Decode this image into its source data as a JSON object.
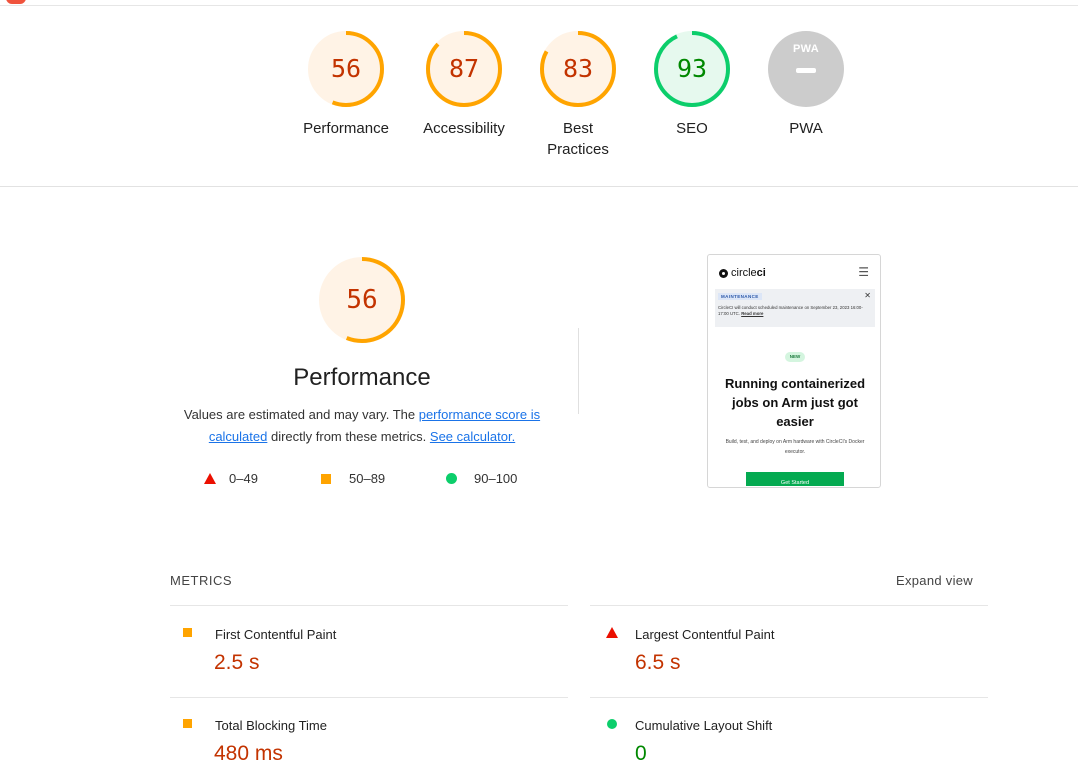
{
  "colors": {
    "fail": "#eb0f00",
    "average": "#ffa400",
    "pass": "#0cce6b",
    "fail_text": "#c33300",
    "average_text": "#c33300",
    "pass_text": "#008800",
    "na": "#cccccc",
    "link": "#1a73e8"
  },
  "categories": [
    {
      "score": "56",
      "label": "Performance",
      "rating": "average",
      "fraction": 0.56
    },
    {
      "score": "87",
      "label": "Accessibility",
      "rating": "average",
      "fraction": 0.87
    },
    {
      "score": "83",
      "label": "Best Practices",
      "rating": "average",
      "fraction": 0.83
    },
    {
      "score": "93",
      "label": "SEO",
      "rating": "pass",
      "fraction": 0.93
    },
    {
      "score": "",
      "label": "PWA",
      "rating": "na",
      "badge_text": "PWA",
      "icon": "pwa-badge-icon"
    }
  ],
  "performance": {
    "score": "56",
    "fraction": 0.56,
    "title": "Performance",
    "desc_prefix": "Values are estimated and may vary. The ",
    "desc_link1": "performance score is calculated",
    "desc_middle": " directly from these metrics. ",
    "desc_link2": "See calculator.",
    "legend": [
      {
        "icon": "triangle-fail-icon",
        "range": "0–49"
      },
      {
        "icon": "square-average-icon",
        "range": "50–89"
      },
      {
        "icon": "circle-pass-icon",
        "range": "90–100"
      }
    ]
  },
  "screenshot": {
    "brand_prefix": "circle",
    "brand_bold": "ci",
    "menu_icon": "hamburger-menu-icon",
    "banner_badge": "MAINTENANCE",
    "banner_text": "CircleCI will conduct scheduled maintenance on September 23, 2023 16:00-17:00 UTC.",
    "banner_link": "Read more",
    "new_badge": "NEW",
    "headline": "Running containerized jobs on Arm just got easier",
    "subtext": "Build, test, and deploy on Arm hardware with CircleCI's Docker executor.",
    "cta": "Get Started"
  },
  "metrics": {
    "heading": "METRICS",
    "expand_label": "Expand view",
    "items": [
      {
        "name": "First Contentful Paint",
        "value": "2.5 s",
        "rating": "average",
        "icon": "square-average-icon"
      },
      {
        "name": "Largest Contentful Paint",
        "value": "6.5 s",
        "rating": "fail",
        "icon": "triangle-fail-icon"
      },
      {
        "name": "Total Blocking Time",
        "value": "480 ms",
        "rating": "average",
        "icon": "square-average-icon"
      },
      {
        "name": "Cumulative Layout Shift",
        "value": "0",
        "rating": "pass",
        "icon": "circle-pass-icon"
      }
    ]
  }
}
